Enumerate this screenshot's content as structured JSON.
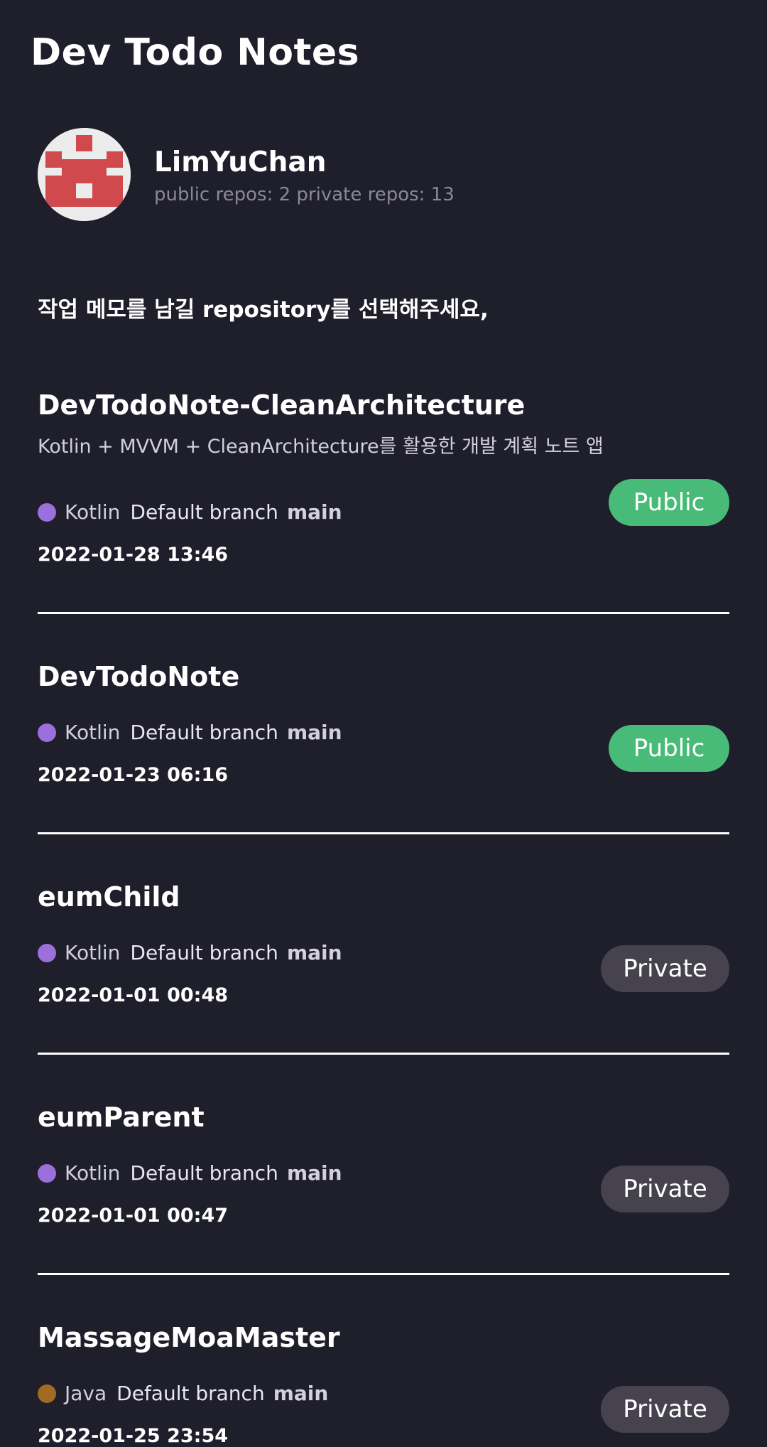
{
  "app": {
    "title": "Dev Todo Notes"
  },
  "profile": {
    "username": "LimYuChan",
    "repo_counts": "public repos: 2 private repos: 13",
    "avatar_icon": "identicon-avatar-icon"
  },
  "prompt": "작업 메모를 남길 repository를 선택해주세요,",
  "colors": {
    "background": "#1f1e2b",
    "public_badge": "#48bb78",
    "private_badge": "#46434f",
    "kotlin": "#9b6fdc",
    "java": "#a36a23",
    "avatar_red": "#d04a4d"
  },
  "repos": [
    {
      "name": "DevTodoNote-CleanArchitecture",
      "description": "Kotlin + MVVM + CleanArchitecture를 활용한 개발 계획 노트 앱",
      "language": "Kotlin",
      "language_color": "#9b6fdc",
      "branch_label": "Default branch",
      "branch": "main",
      "date": "2022-01-28 13:46",
      "visibility": "Public"
    },
    {
      "name": "DevTodoNote",
      "description": "",
      "language": "Kotlin",
      "language_color": "#9b6fdc",
      "branch_label": "Default branch",
      "branch": "main",
      "date": "2022-01-23 06:16",
      "visibility": "Public"
    },
    {
      "name": "eumChild",
      "description": "",
      "language": "Kotlin",
      "language_color": "#9b6fdc",
      "branch_label": "Default branch",
      "branch": "main",
      "date": "2022-01-01 00:48",
      "visibility": "Private"
    },
    {
      "name": "eumParent",
      "description": "",
      "language": "Kotlin",
      "language_color": "#9b6fdc",
      "branch_label": "Default branch",
      "branch": "main",
      "date": "2022-01-01 00:47",
      "visibility": "Private"
    },
    {
      "name": "MassageMoaMaster",
      "description": "",
      "language": "Java",
      "language_color": "#a36a23",
      "branch_label": "Default branch",
      "branch": "main",
      "date": "2022-01-25 23:54",
      "visibility": "Private"
    }
  ]
}
